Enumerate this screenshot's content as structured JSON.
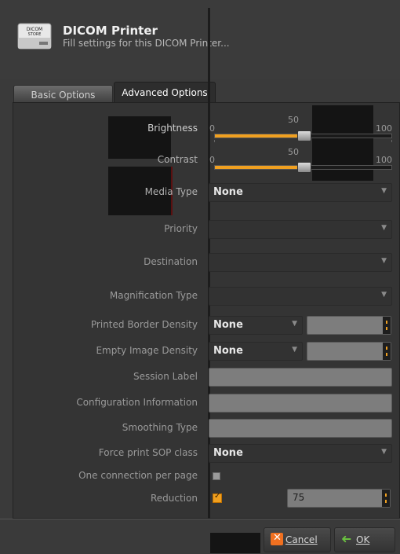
{
  "header": {
    "title": "DICOM Printer",
    "subtitle": "Fill settings for this DICOM Printer...",
    "icon": "dicom-store-printer-icon",
    "icon_text": "DICOM STORE"
  },
  "tabs": [
    {
      "label": "Basic Options",
      "active": false
    },
    {
      "label": "Advanced Options",
      "active": true
    }
  ],
  "brightness": {
    "label": "Brightness",
    "min": "0",
    "max": "100",
    "value": "50",
    "fraction": 0.5
  },
  "contrast": {
    "label": "Contrast",
    "min": "0",
    "max": "100",
    "value": "50",
    "fraction": 0.5
  },
  "media_type": {
    "label": "Media Type",
    "value": "None"
  },
  "priority": {
    "label": "Priority",
    "value": ""
  },
  "destination": {
    "label": "Destination",
    "value": ""
  },
  "magnification_type": {
    "label": "Magnification Type",
    "value": ""
  },
  "printed_border_density": {
    "label": "Printed Border Density",
    "value": "None",
    "spin_value": ""
  },
  "empty_image_density": {
    "label": "Empty Image Density",
    "value": "None",
    "spin_value": ""
  },
  "session_label": {
    "label": "Session Label",
    "value": ""
  },
  "configuration_information": {
    "label": "Configuration Information",
    "value": ""
  },
  "smoothing_type": {
    "label": "Smoothing Type",
    "value": ""
  },
  "force_print_sop_class": {
    "label": "Force print SOP class",
    "value": "None"
  },
  "one_connection_per_page": {
    "label": "One connection per page",
    "checked": false
  },
  "reduction": {
    "label": "Reduction",
    "checked": true,
    "value": "75"
  },
  "footer": {
    "cancel_label": "Cancel",
    "ok_label": "OK"
  },
  "colors": {
    "accent": "#f0a020",
    "background": "#3a3a3a",
    "field": "#7d7d7d"
  }
}
